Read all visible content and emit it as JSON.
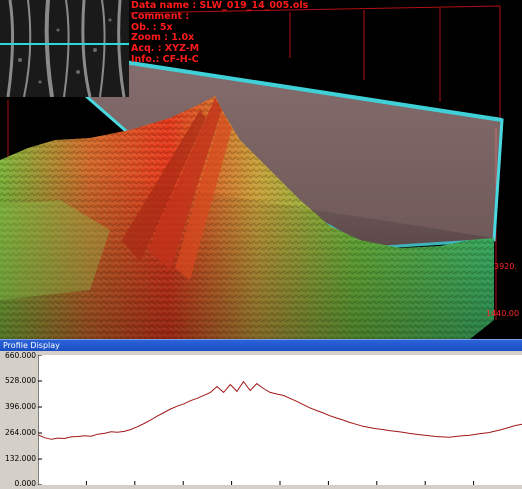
{
  "info_overlay": {
    "lines": [
      "Data name : SLW_019_14_005.ols",
      "Comment    :",
      "Ob.  : 5x",
      "Zoom : 1.0x",
      "Acq. : XYZ-M",
      "Info.: CF-H-C"
    ]
  },
  "axis_labels": {
    "y_extent": "3920.",
    "x_extent": "1440.00"
  },
  "profile": {
    "title": "Profile Display",
    "y_ticks": [
      "660.000",
      "528.000",
      "396.000",
      "264.000",
      "132.000",
      "0.000"
    ],
    "ylim": [
      0,
      660
    ],
    "line_color": "#a01818"
  },
  "chart_data": {
    "type": "line",
    "title": "Profile Display",
    "xlabel": "",
    "ylabel": "",
    "ylim": [
      0,
      660
    ],
    "y_ticks": [
      0,
      132,
      264,
      396,
      528,
      660
    ],
    "grid": false,
    "series": [
      {
        "values": [
          255,
          240,
          232,
          238,
          236,
          244,
          246,
          250,
          248,
          258,
          262,
          270,
          268,
          272,
          282,
          296,
          312,
          330,
          350,
          368,
          386,
          400,
          412,
          428,
          440,
          455,
          470,
          500,
          470,
          510,
          475,
          525,
          480,
          515,
          490,
          470,
          462,
          455,
          440,
          425,
          408,
          392,
          378,
          366,
          352,
          340,
          330,
          318,
          308,
          298,
          292,
          286,
          282,
          276,
          272,
          268,
          262,
          258,
          254,
          250,
          246,
          244,
          242,
          246,
          250,
          252,
          258,
          262,
          266,
          274,
          282,
          292,
          302,
          308
        ]
      }
    ]
  }
}
